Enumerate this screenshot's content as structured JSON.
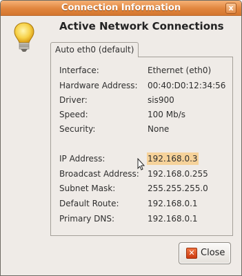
{
  "window": {
    "title": "Connection Information",
    "close_glyph": "x",
    "heading": "Active Network Connections"
  },
  "tab": {
    "label": "Auto eth0 (default)"
  },
  "info": {
    "interface": {
      "label": "Interface:",
      "value": "Ethernet (eth0)"
    },
    "hardware_address": {
      "label": "Hardware Address:",
      "value": "00:40:D0:12:34:56"
    },
    "driver": {
      "label": "Driver:",
      "value": "sis900"
    },
    "speed": {
      "label": "Speed:",
      "value": "100 Mb/s"
    },
    "security": {
      "label": "Security:",
      "value": "None"
    },
    "ip_address": {
      "label": "IP Address:",
      "value": "192.168.0.3"
    },
    "broadcast_address": {
      "label": "Broadcast Address:",
      "value": "192.168.0.255"
    },
    "subnet_mask": {
      "label": "Subnet Mask:",
      "value": "255.255.255.0"
    },
    "default_route": {
      "label": "Default Route:",
      "value": "192.168.0.1"
    },
    "primary_dns": {
      "label": "Primary DNS:",
      "value": "192.168.0.1"
    }
  },
  "buttons": {
    "close_label": "Close",
    "close_icon": "close-icon"
  },
  "colors": {
    "titlebar": "#e1853d",
    "selection": "#f6d29a",
    "window_bg": "#efebe7"
  }
}
